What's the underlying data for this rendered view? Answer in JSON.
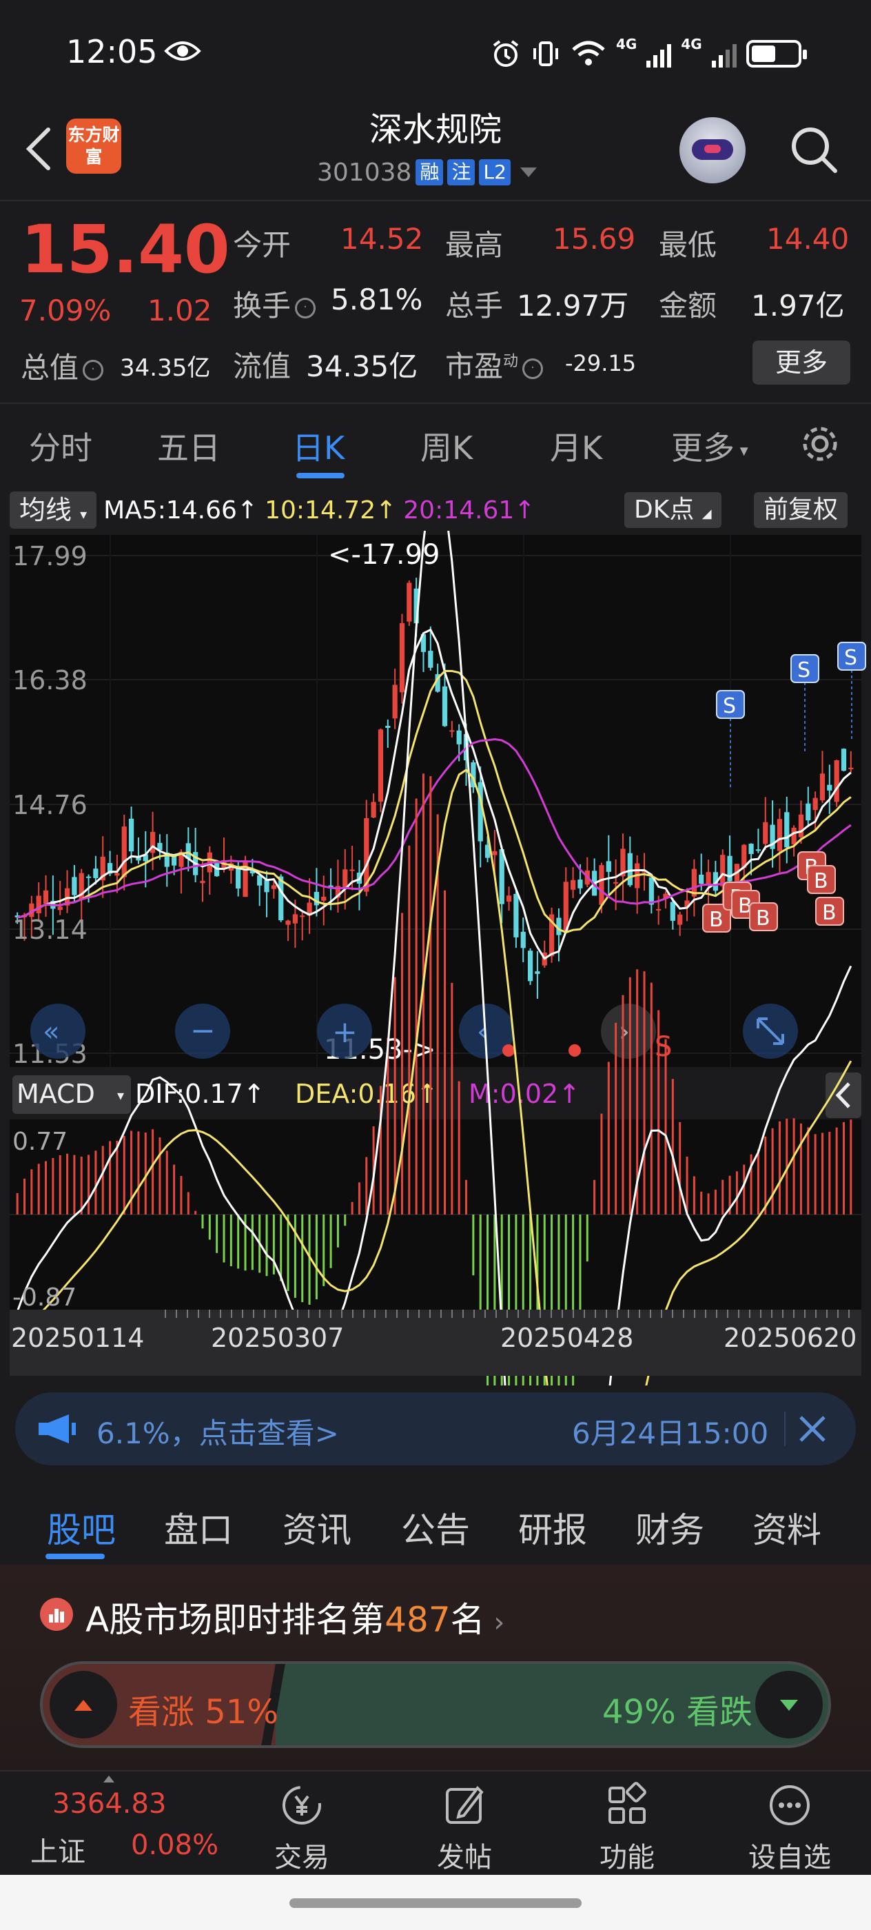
{
  "status_bar": {
    "time": "12:05",
    "net1": "4G",
    "net2": "4G"
  },
  "header": {
    "stock_name": "深水规院",
    "code": "301038",
    "tags": [
      "融",
      "注",
      "L2"
    ],
    "logo_text": "东方财富"
  },
  "quote": {
    "price": "15.40",
    "change_pct": "7.09%",
    "change": "1.02",
    "fields": [
      {
        "label": "今开",
        "value": "14.52"
      },
      {
        "label": "最高",
        "value": "15.69"
      },
      {
        "label": "最低",
        "value": "14.40"
      },
      {
        "label": "换手",
        "value": "5.81%"
      },
      {
        "label": "总手",
        "value": "12.97万"
      },
      {
        "label": "金额",
        "value": "1.97亿"
      },
      {
        "label": "流值",
        "value": "34.35亿"
      },
      {
        "label": "市盈",
        "value": "-29.15",
        "superscript": "动"
      }
    ],
    "market_cap_label": "总值",
    "market_cap": "34.35亿",
    "more_label": "更多"
  },
  "period_tabs": [
    "分时",
    "五日",
    "日K",
    "周K",
    "月K",
    "更多"
  ],
  "active_period": "日K",
  "indicator_bar": {
    "selector": "均线",
    "ma5": "MA5:14.66↑",
    "ma10": "10:14.72↑",
    "ma20": "20:14.61↑",
    "dk_label": "DK点",
    "fq_label": "前复权"
  },
  "kline_chart": {
    "y_ticks": [
      "17.99",
      "16.38",
      "14.76",
      "13.14",
      "11.53"
    ],
    "high_marker": "<-17.99",
    "low_marker": "11.53->",
    "signals_s": [
      "S",
      "S",
      "S"
    ],
    "signals_b": [
      "B",
      "B",
      "B",
      "B",
      "B",
      "B",
      "B"
    ],
    "s_red": "S"
  },
  "macd": {
    "selector": "MACD",
    "dif": "DIF:0.17↑",
    "dea": "DEA:0.16↑",
    "m": "M:0.02↑",
    "y_top": "0.77",
    "y_bottom": "-0.87"
  },
  "x_dates": [
    "20250114",
    "20250307",
    "20250428",
    "20250620"
  ],
  "banner": {
    "text": "6.1%，点击查看>",
    "time": "6月24日15:00"
  },
  "bottom_tabs": [
    "股吧",
    "盘口",
    "资讯",
    "公告",
    "研报",
    "财务",
    "资料"
  ],
  "active_bottom_tab": "股吧",
  "ranking": {
    "prefix": "A股市场即时排名第",
    "rank": "487",
    "suffix": "名"
  },
  "vote": {
    "up_label": "看涨 51%",
    "down_label": "49% 看跌",
    "up_fraction": 0.51
  },
  "footer": {
    "index_value": "3364.83",
    "index_name": "上证",
    "index_change": "0.08%",
    "items": [
      "交易",
      "发帖",
      "功能",
      "设自选"
    ]
  },
  "colors": {
    "up": "#e8453c",
    "down": "#5ec46a",
    "accent": "#3b8cf5",
    "ma5": "#ffffff",
    "ma10": "#f4e46b",
    "ma20": "#d13cd4"
  }
}
